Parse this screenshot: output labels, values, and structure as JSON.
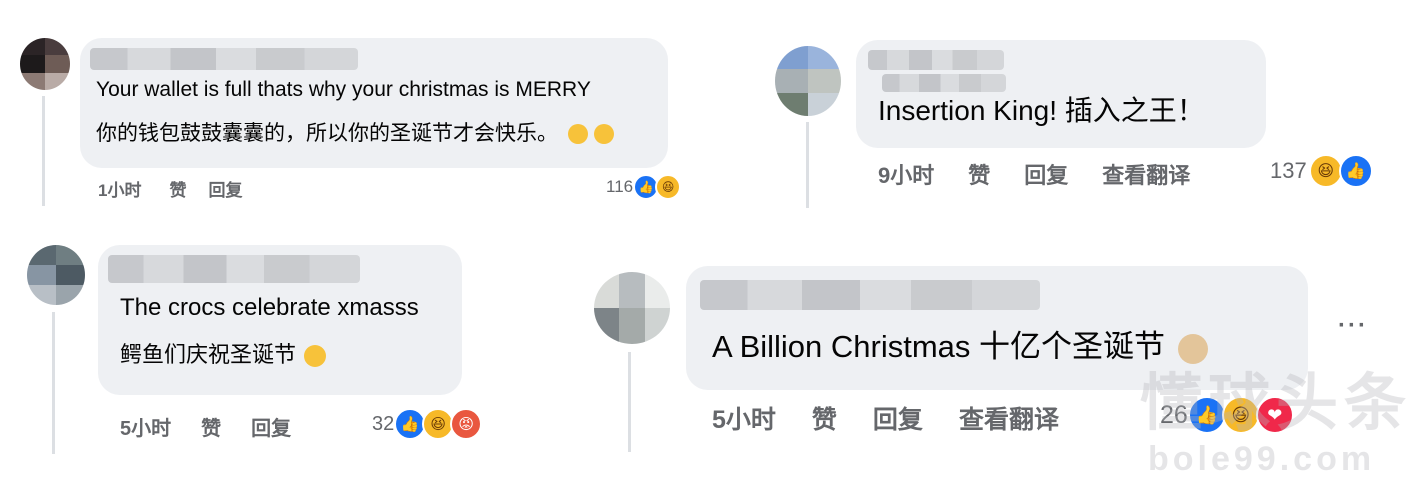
{
  "comments": [
    {
      "body_en": "Your wallet is full thats why your christmas is MERRY",
      "body_zh": "你的钱包鼓鼓囊囊的，所以你的圣诞节才会快乐。",
      "time": "1小时",
      "like": "赞",
      "reply": "回复",
      "reaction_count": "116"
    },
    {
      "body": "Insertion King!  插入之王！",
      "time": "9小时",
      "like": "赞",
      "reply": "回复",
      "translate": "查看翻译",
      "reaction_count": "137"
    },
    {
      "body_en": "The crocs celebrate xmasss",
      "body_zh": "鳄鱼们庆祝圣诞节",
      "time": "5小时",
      "like": "赞",
      "reply": "回复",
      "reaction_count": "32"
    },
    {
      "body": "A Billion Christmas   十亿个圣诞节",
      "time": "5小时",
      "like": "赞",
      "reply": "回复",
      "translate": "查看翻译",
      "reaction_count": "26",
      "more": "···"
    }
  ],
  "icons": {
    "like": "like-reaction-icon",
    "haha": "haha-reaction-icon",
    "angry": "angry-reaction-icon",
    "love": "love-reaction-icon"
  },
  "colors": {
    "bubble": "#eef0f3",
    "meta_text": "#65676b",
    "like_blue": "#1a72f5",
    "haha_yellow": "#f7b928",
    "angry_red": "#e9573f",
    "love_red": "#f0284a"
  },
  "watermark": {
    "line1": "懂球头条",
    "line2": "bole99.com"
  }
}
